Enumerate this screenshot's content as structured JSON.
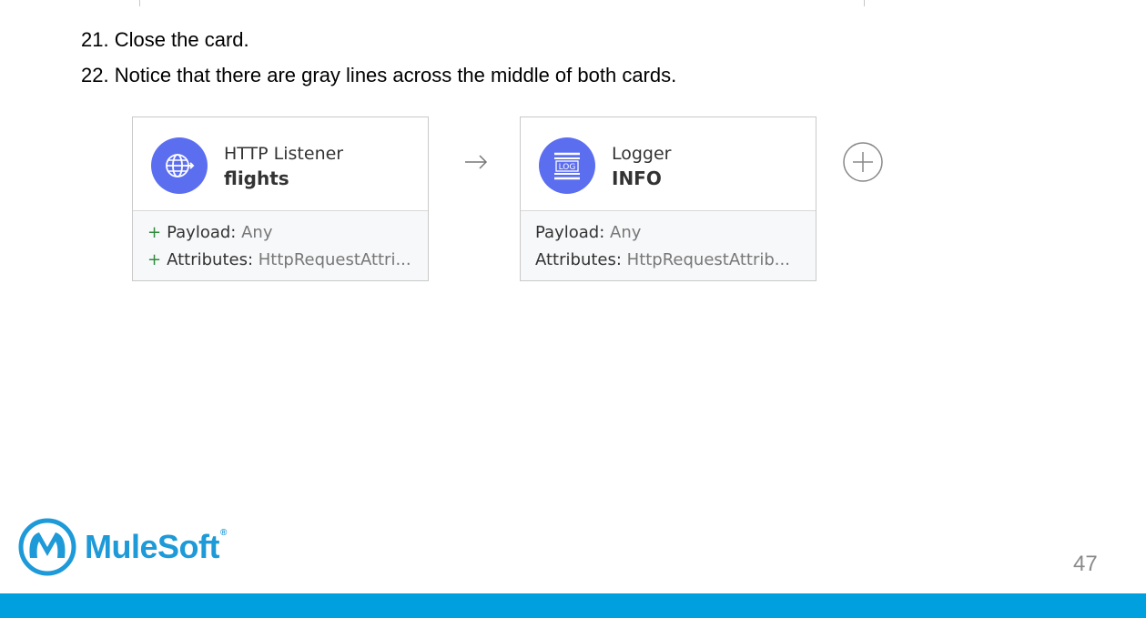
{
  "steps": [
    {
      "text": "21. Close the card."
    },
    {
      "text": "22. Notice that there are gray lines across the middle of both cards."
    }
  ],
  "cards": [
    {
      "title": "HTTP Listener",
      "subtitle": "flights",
      "icon": "globe-icon",
      "rows": [
        {
          "marker": "+",
          "label": "Payload:",
          "value": "Any"
        },
        {
          "marker": "+",
          "label": "Attributes:",
          "value": "HttpRequestAttri..."
        }
      ]
    },
    {
      "title": "Logger",
      "subtitle": "INFO",
      "icon": "log-icon",
      "rows": [
        {
          "label": "Payload:",
          "value": "Any"
        },
        {
          "label": "Attributes:",
          "value": "HttpRequestAttrib..."
        }
      ]
    }
  ],
  "footer": {
    "brand": "MuleSoft",
    "trademark": "®",
    "page_number": "47"
  },
  "colors": {
    "icon_bg": "#5c6ef0",
    "brand_blue": "#1e9ad8",
    "bottom_bar": "#00a0df"
  }
}
